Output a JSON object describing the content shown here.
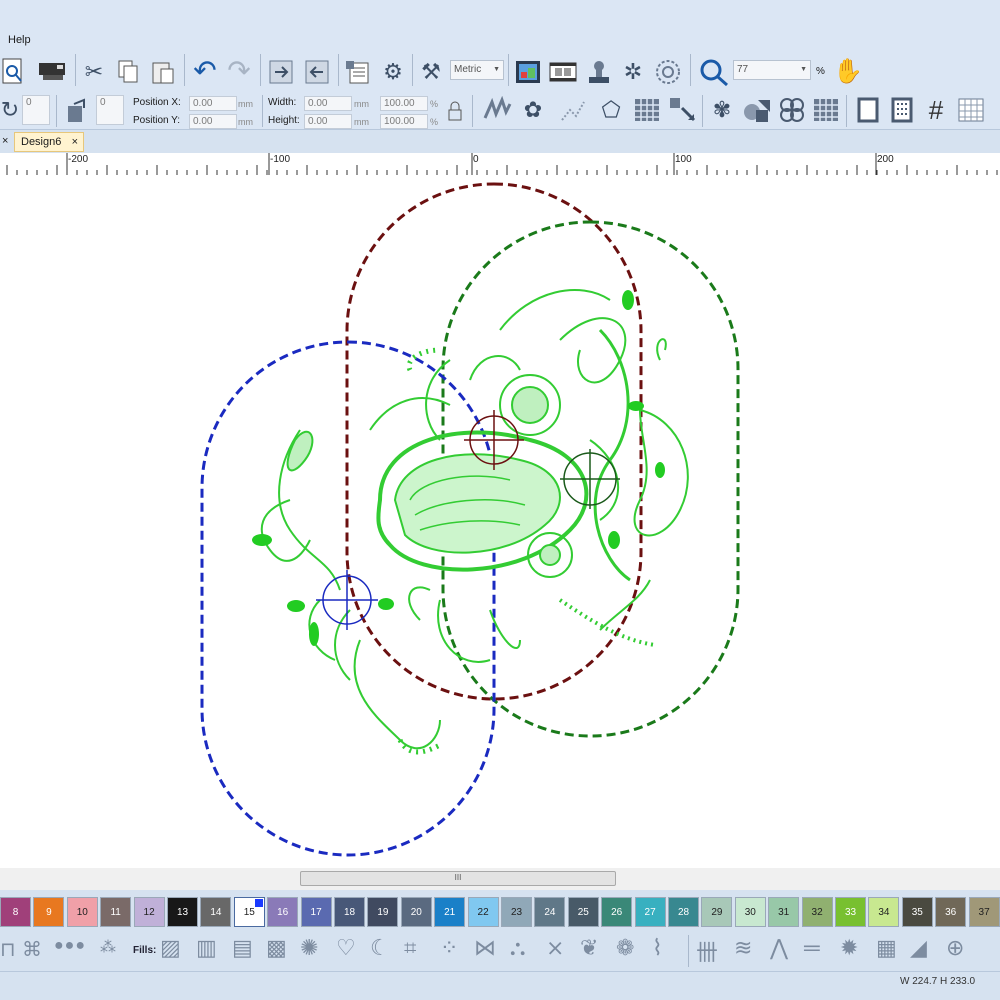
{
  "menu": {
    "help": "Help"
  },
  "toolbar": {
    "units": "Metric",
    "zoom_value": "77",
    "zoom_unit": "%",
    "rotate_value": "0",
    "slant_value": "0",
    "position_x_label": "Position X:",
    "position_y_label": "Position Y:",
    "position_x": "0.00",
    "position_y": "0.00",
    "width_label": "Width:",
    "height_label": "Height:",
    "width": "0.00",
    "height": "0.00",
    "width_pct": "100.00",
    "height_pct": "100.00",
    "mm": "mm",
    "pct": "%"
  },
  "tabs": {
    "close": "×",
    "design": "Design6",
    "design_close": "×"
  },
  "ruler": {
    "labels": [
      "-200",
      "-100",
      "0",
      "100",
      "200"
    ]
  },
  "scroll": {
    "grip": "III"
  },
  "palette": {
    "selected": "15",
    "swatches": [
      {
        "n": "8",
        "c": "#a0407a"
      },
      {
        "n": "9",
        "c": "#e87820"
      },
      {
        "n": "10",
        "c": "#f0a0a8"
      },
      {
        "n": "11",
        "c": "#7a6a68"
      },
      {
        "n": "12",
        "c": "#c0b0d8"
      },
      {
        "n": "13",
        "c": "#181818"
      },
      {
        "n": "14",
        "c": "#686868"
      },
      {
        "n": "15",
        "c": "#ffffff"
      },
      {
        "n": "16",
        "c": "#8a7ab8"
      },
      {
        "n": "17",
        "c": "#5a6ab0"
      },
      {
        "n": "18",
        "c": "#485878"
      },
      {
        "n": "19",
        "c": "#404a60"
      },
      {
        "n": "20",
        "c": "#5a6a80"
      },
      {
        "n": "21",
        "c": "#1a80c8"
      },
      {
        "n": "22",
        "c": "#80c8f0"
      },
      {
        "n": "23",
        "c": "#90a8b8"
      },
      {
        "n": "24",
        "c": "#607888"
      },
      {
        "n": "25",
        "c": "#485a68"
      },
      {
        "n": "26",
        "c": "#3a8878"
      },
      {
        "n": "27",
        "c": "#38b0c0"
      },
      {
        "n": "28",
        "c": "#388890"
      },
      {
        "n": "29",
        "c": "#a8c8b8"
      },
      {
        "n": "30",
        "c": "#c8e8d0"
      },
      {
        "n": "31",
        "c": "#98c8a8"
      },
      {
        "n": "32",
        "c": "#90b070"
      },
      {
        "n": "33",
        "c": "#78c030"
      },
      {
        "n": "34",
        "c": "#c8e890"
      },
      {
        "n": "35",
        "c": "#4a4a40"
      },
      {
        "n": "36",
        "c": "#706858"
      },
      {
        "n": "37",
        "c": "#a09878"
      }
    ]
  },
  "fills": {
    "label": "Fills:"
  },
  "status": {
    "size": "W 224.7 H 233.0"
  }
}
